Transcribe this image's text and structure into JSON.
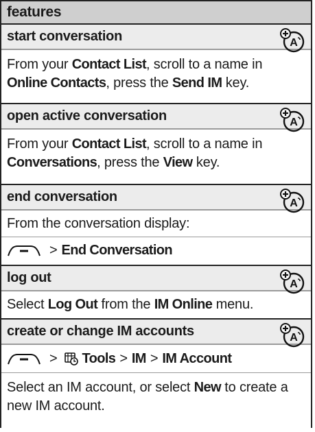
{
  "header": {
    "title": "features"
  },
  "sections": [
    {
      "title": "start conversation",
      "text": [
        {
          "t": "From your ",
          "b": false
        },
        {
          "t": "Contact List",
          "b": true
        },
        {
          "t": ", scroll to a name in ",
          "b": false
        },
        {
          "t": "Online Contacts",
          "b": true
        },
        {
          "t": ", press the ",
          "b": false
        },
        {
          "t": "Send IM",
          "b": true
        },
        {
          "t": " key.",
          "b": false
        }
      ]
    },
    {
      "title": "open active conversation",
      "text": [
        {
          "t": "From your ",
          "b": false
        },
        {
          "t": "Contact List",
          "b": true
        },
        {
          "t": ", scroll to a name in ",
          "b": false
        },
        {
          "t": "Conversations",
          "b": true
        },
        {
          "t": ", press the ",
          "b": false
        },
        {
          "t": "View",
          "b": true
        },
        {
          "t": " key.",
          "b": false
        }
      ]
    },
    {
      "title": "end conversation",
      "line1": "From the conversation display:",
      "path": [
        "End Conversation"
      ]
    },
    {
      "title": "log out",
      "text": [
        {
          "t": "Select ",
          "b": false
        },
        {
          "t": "Log Out",
          "b": true
        },
        {
          "t": " from the ",
          "b": false
        },
        {
          "t": "IM Online",
          "b": true
        },
        {
          "t": " menu.",
          "b": false
        }
      ]
    },
    {
      "title": "create or change IM accounts",
      "path": [
        "Tools",
        "IM",
        "IM Account"
      ],
      "text": [
        {
          "t": "Select an IM account, or select ",
          "b": false
        },
        {
          "t": "New",
          "b": true
        },
        {
          "t": " to create a new IM account.",
          "b": false
        }
      ]
    }
  ],
  "separator": ">"
}
